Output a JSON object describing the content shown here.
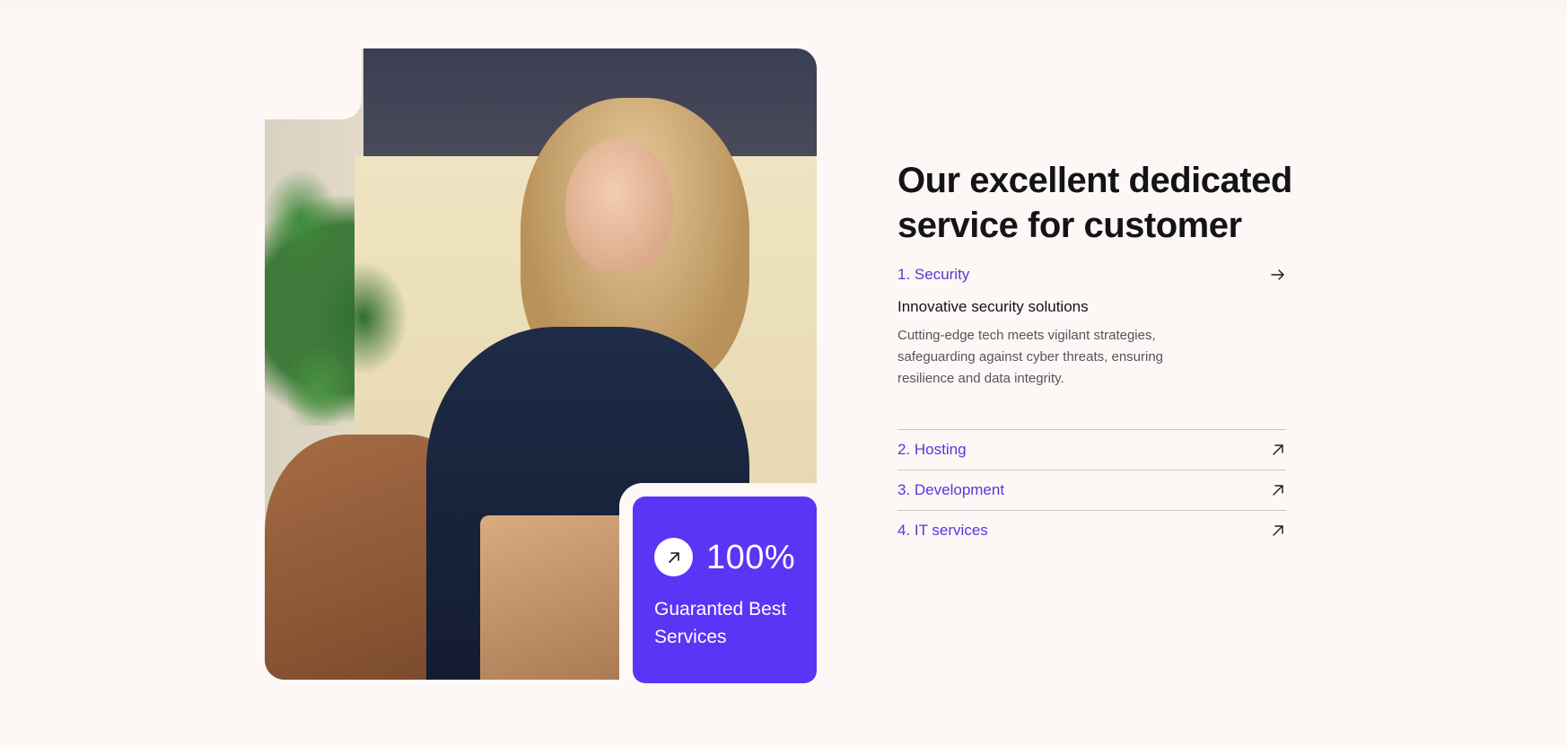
{
  "hero_image": {
    "alt": "Smiling woman with glasses talking on the phone while holding a laptop"
  },
  "stat_card": {
    "icon": "arrow-up-right-icon",
    "value": "100%",
    "label": "Guaranted Best Services",
    "color": "#5b35f5"
  },
  "heading": "Our excellent dedicated service for customer",
  "accordion": [
    {
      "title": "1. Security",
      "expanded": true,
      "icon": "arrow-right-icon",
      "subtitle": "Innovative security solutions",
      "description": "Cutting-edge tech meets vigilant strategies, safeguarding against cyber threats, ensuring resilience and data integrity."
    },
    {
      "title": "2. Hosting",
      "expanded": false,
      "icon": "arrow-up-right-icon"
    },
    {
      "title": "3. Development",
      "expanded": false,
      "icon": "arrow-up-right-icon"
    },
    {
      "title": "4. IT services",
      "expanded": false,
      "icon": "arrow-up-right-icon"
    }
  ],
  "colors": {
    "accent": "#5b35f5",
    "accent_text": "#5b35d6",
    "background": "#fdf8f6",
    "heading": "#141318"
  }
}
